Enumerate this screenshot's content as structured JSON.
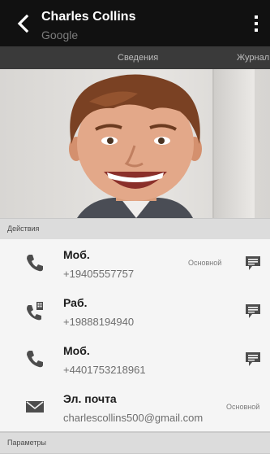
{
  "header": {
    "title": "Charles Collins",
    "subtitle": "Google",
    "back_icon": "chevron-left-icon",
    "menu_icon": "more-vert-icon"
  },
  "tabs": [
    {
      "label": "Сведения"
    },
    {
      "label": "Журнал"
    }
  ],
  "photo": {
    "description_icon": "contact-photo"
  },
  "sections": {
    "actions": "Действия",
    "params": "Параметры"
  },
  "rows": [
    {
      "type": "Моб.",
      "value": "+19405557757",
      "badge": "Основной",
      "icon": "phone-icon",
      "action_icon": "message-icon"
    },
    {
      "type": "Раб.",
      "value": "+19888194940",
      "badge": "",
      "icon": "work-phone-icon",
      "action_icon": "message-icon"
    },
    {
      "type": "Моб.",
      "value": "+4401753218961",
      "badge": "",
      "icon": "phone-icon",
      "action_icon": "message-icon"
    },
    {
      "type": "Эл. почта",
      "value": "charlescollins500@gmail.com",
      "badge": "Основной",
      "icon": "email-icon",
      "action_icon": ""
    }
  ],
  "colors": {
    "topbar": "#111111",
    "tabbar": "#3a3a3a",
    "row_bg": "#f5f5f5",
    "section_bg": "#dcdcdc"
  }
}
